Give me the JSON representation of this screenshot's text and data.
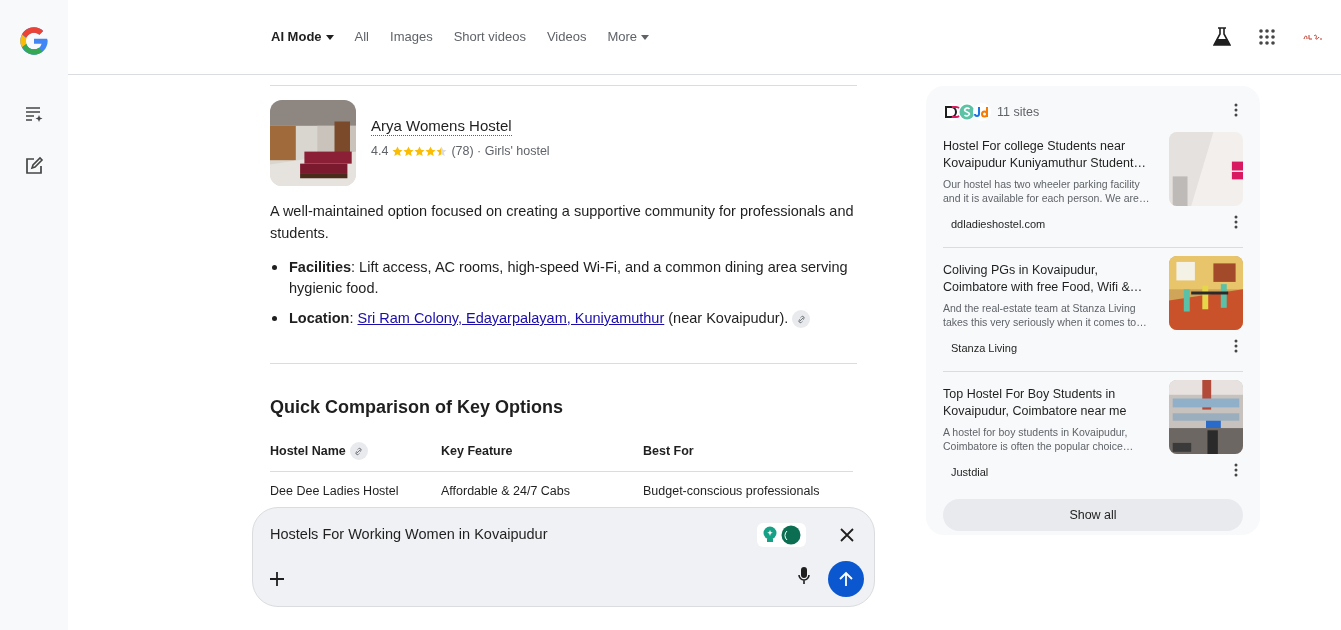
{
  "nav": {
    "tabs": [
      {
        "label": "AI Mode",
        "selected": true,
        "dropdown": true
      },
      {
        "label": "All",
        "selected": false,
        "dropdown": false
      },
      {
        "label": "Images",
        "selected": false,
        "dropdown": false
      },
      {
        "label": "Short videos",
        "selected": false,
        "dropdown": false
      },
      {
        "label": "Videos",
        "selected": false,
        "dropdown": false
      },
      {
        "label": "More",
        "selected": false,
        "dropdown": true
      }
    ]
  },
  "place": {
    "name": "Arya Womens Hostel",
    "rating": "4.4",
    "stars": 4.5,
    "details": "(78) · Girls' hostel"
  },
  "description": "A well-maintained option focused on creating a supportive community for professionals and students.",
  "bullets": [
    {
      "lead": "**Facilities**: Lift access, AC rooms, high-speed Wi-Fi, and a common dining area serving hygienic food.",
      "cite": false
    },
    {
      "lead": "**Location**: ",
      "link": "Sri Ram Colony, Edayarpalayam, Kuniyamuthur",
      "tail": " (near Kovaipudur).",
      "cite": true
    }
  ],
  "comparison": {
    "title": "Quick Comparison of Key Options",
    "columns": [
      {
        "label": "Hostel Name",
        "cite": true
      },
      {
        "label": "Key Feature",
        "cite": false
      },
      {
        "label": "Best For",
        "cite": false
      }
    ],
    "rows": [
      [
        "Dee Dee Ladies Hostel",
        "Affordable & 24/7 Cabs",
        "Budget-conscious professionals"
      ]
    ]
  },
  "prompt": {
    "value": "Hostels For Working Women in Kovaipudur"
  },
  "sources": {
    "count": "11 sites",
    "items": [
      {
        "title": "Hostel For college Students near Kovaipudur Kuniyamuthur Student…",
        "snippet": "Our hostel has two wheeler parking facility and it is available for each person. We are…",
        "site": "ddladieshostel.com",
        "kind": "dd"
      },
      {
        "title": "Coliving PGs in Kovaipudur, Coimbatore with free Food, Wifi &…",
        "snippet": "And the real-estate team at Stanza Living takes this very seriously when it comes to…",
        "site": "Stanza Living",
        "kind": "stanza"
      },
      {
        "title": "Top Hostel For Boy Students in Kovaipudur, Coimbatore near me",
        "snippet": "A hostel for boy students in Kovaipudur, Coimbatore is often the popular choice…",
        "site": "Justdial",
        "kind": "jd"
      }
    ],
    "button": "Show all"
  }
}
